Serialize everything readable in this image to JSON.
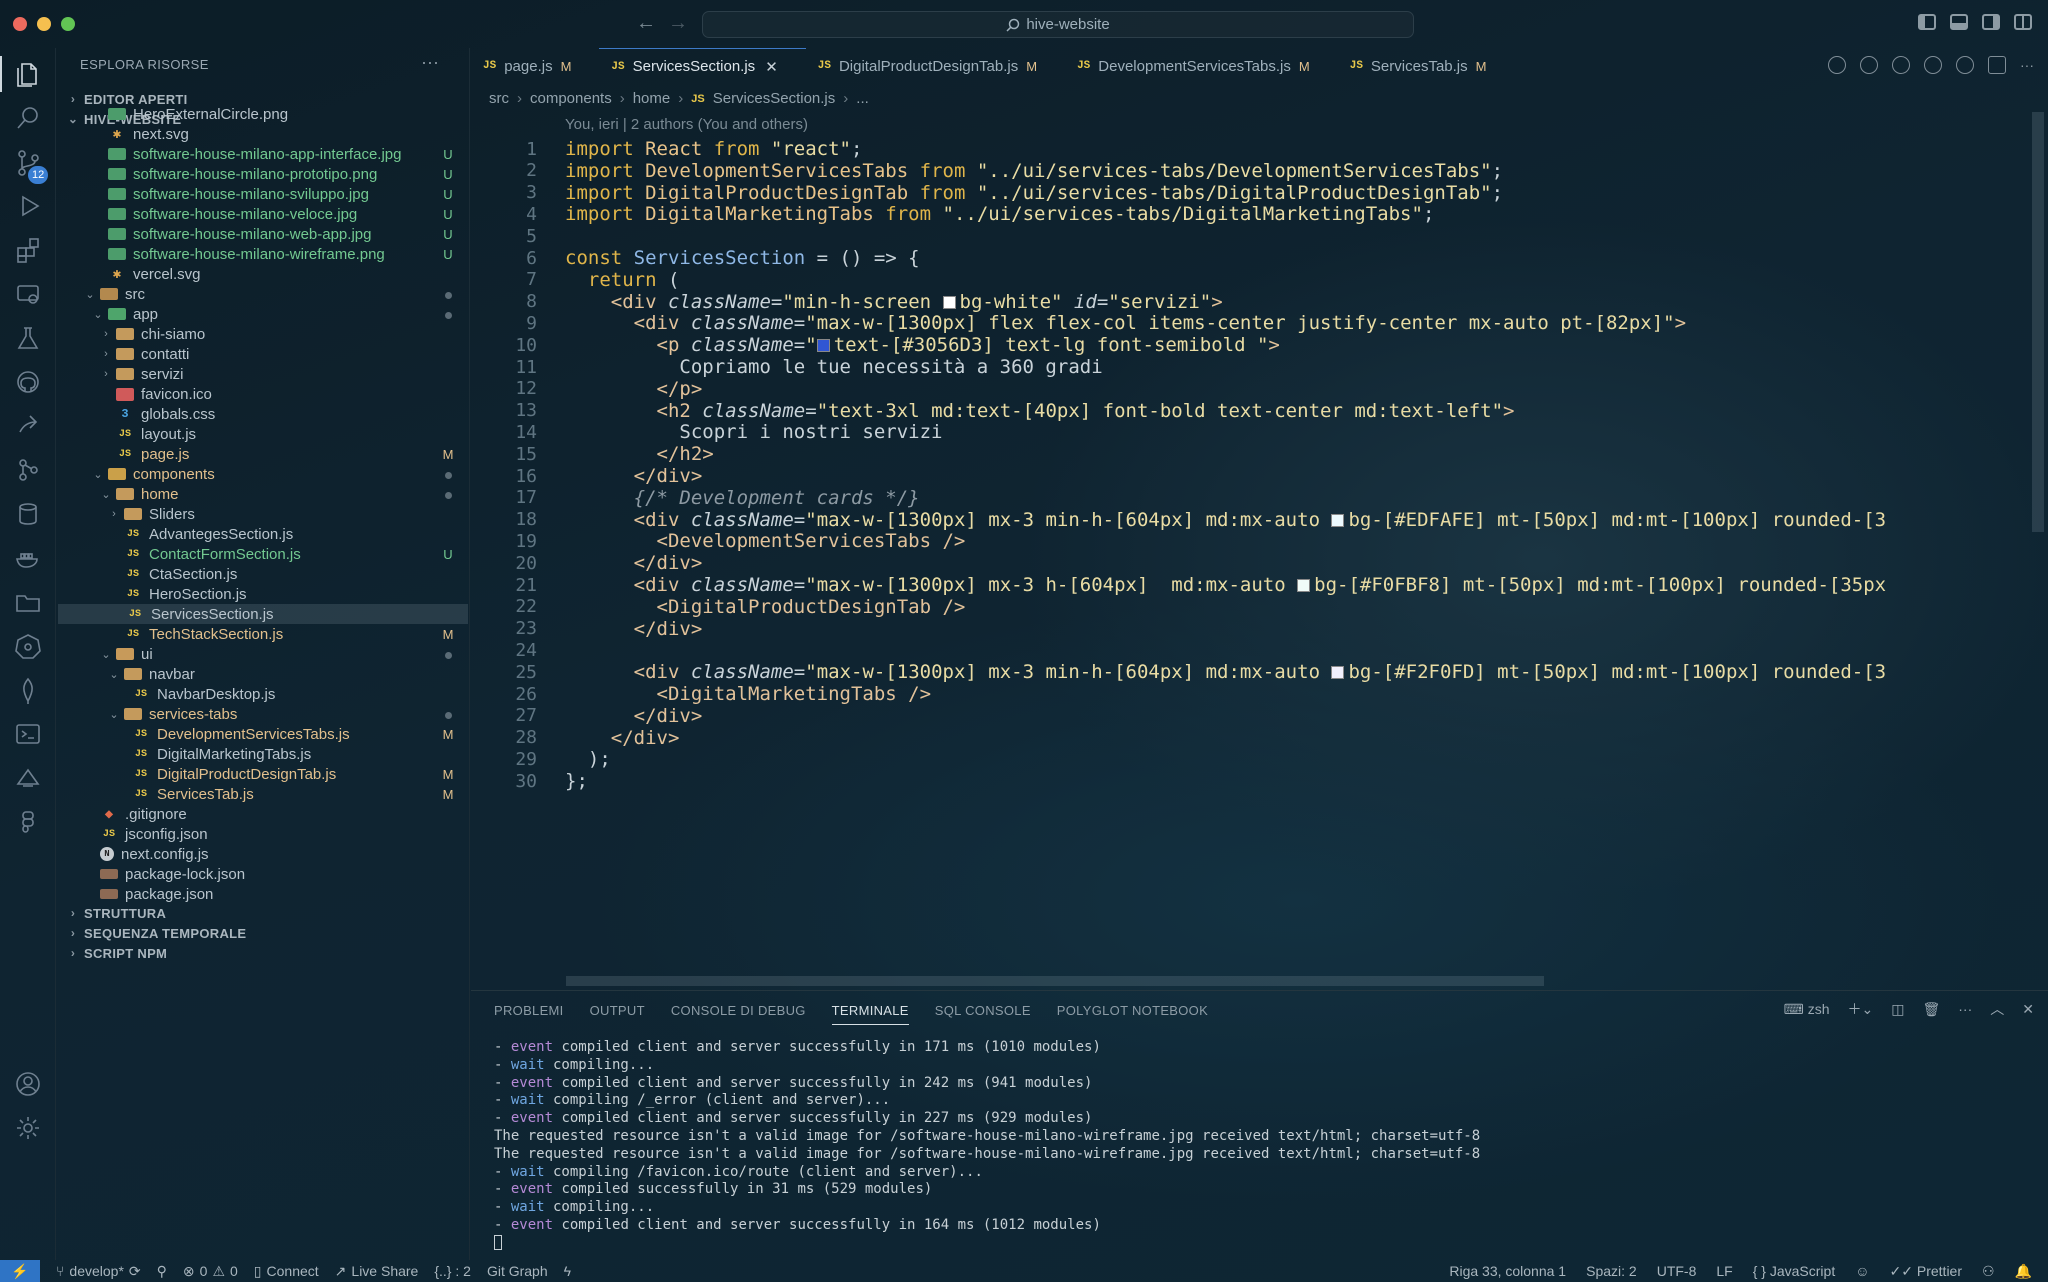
{
  "window": {
    "search": "hive-website"
  },
  "sidebar": {
    "title": "ESPLORA RISORSE",
    "sections": {
      "open_editors": "EDITOR APERTI",
      "project": "HIVE-WEBSITE",
      "outline": "STRUTTURA",
      "timeline": "SEQUENZA TEMPORALE",
      "npm": "SCRIPT NPM"
    },
    "source_control_badge": "12",
    "tree": [
      {
        "name": "HeroExternalCircle.png",
        "icon": "img",
        "indent": 1,
        "status": "",
        "color": "plain"
      },
      {
        "name": "next.svg",
        "icon": "svg",
        "indent": 1,
        "status": "",
        "color": "plain"
      },
      {
        "name": "software-house-milano-app-interface.jpg",
        "icon": "img",
        "indent": 1,
        "status": "U",
        "color": "green"
      },
      {
        "name": "software-house-milano-prototipo.png",
        "icon": "img",
        "indent": 1,
        "status": "U",
        "color": "green"
      },
      {
        "name": "software-house-milano-sviluppo.jpg",
        "icon": "img",
        "indent": 1,
        "status": "U",
        "color": "green"
      },
      {
        "name": "software-house-milano-veloce.jpg",
        "icon": "img",
        "indent": 1,
        "status": "U",
        "color": "green"
      },
      {
        "name": "software-house-milano-web-app.jpg",
        "icon": "img",
        "indent": 1,
        "status": "U",
        "color": "green"
      },
      {
        "name": "software-house-milano-wireframe.png",
        "icon": "img",
        "indent": 1,
        "status": "U",
        "color": "green"
      },
      {
        "name": "vercel.svg",
        "icon": "svg",
        "indent": 1,
        "status": "",
        "color": "plain"
      },
      {
        "name": "src",
        "icon": "folder-src",
        "indent": 0,
        "twisty": "open",
        "status": "dot",
        "color": "plain"
      },
      {
        "name": "app",
        "icon": "folder-app",
        "indent": 1,
        "twisty": "open",
        "status": "dot",
        "color": "plain"
      },
      {
        "name": "chi-siamo",
        "icon": "folder",
        "indent": 2,
        "twisty": "closed",
        "status": "",
        "color": "plain"
      },
      {
        "name": "contatti",
        "icon": "folder",
        "indent": 2,
        "twisty": "closed",
        "status": "",
        "color": "plain"
      },
      {
        "name": "servizi",
        "icon": "folder",
        "indent": 2,
        "twisty": "closed",
        "status": "",
        "color": "plain"
      },
      {
        "name": "favicon.ico",
        "icon": "ico",
        "indent": 2,
        "status": "",
        "color": "plain"
      },
      {
        "name": "globals.css",
        "icon": "css",
        "indent": 2,
        "status": "",
        "color": "plain"
      },
      {
        "name": "layout.js",
        "icon": "js",
        "indent": 2,
        "status": "",
        "color": "plain"
      },
      {
        "name": "page.js",
        "icon": "js",
        "indent": 2,
        "status": "M",
        "color": "yellow"
      },
      {
        "name": "components",
        "icon": "folder-comp",
        "indent": 1,
        "twisty": "open",
        "status": "dot",
        "color": "yellow"
      },
      {
        "name": "home",
        "icon": "folder",
        "indent": 2,
        "twisty": "open",
        "status": "dot",
        "color": "yellow"
      },
      {
        "name": "Sliders",
        "icon": "folder",
        "indent": 3,
        "twisty": "closed",
        "status": "",
        "color": "plain"
      },
      {
        "name": "AdvantegesSection.js",
        "icon": "js",
        "indent": 3,
        "status": "",
        "color": "plain"
      },
      {
        "name": "ContactFormSection.js",
        "icon": "js",
        "indent": 3,
        "status": "U",
        "color": "green"
      },
      {
        "name": "CtaSection.js",
        "icon": "js",
        "indent": 3,
        "status": "",
        "color": "plain"
      },
      {
        "name": "HeroSection.js",
        "icon": "js",
        "indent": 3,
        "status": "",
        "color": "plain"
      },
      {
        "name": "ServicesSection.js",
        "icon": "js",
        "indent": 3,
        "status": "",
        "color": "plain",
        "selected": true
      },
      {
        "name": "TechStackSection.js",
        "icon": "js",
        "indent": 3,
        "status": "M",
        "color": "yellow"
      },
      {
        "name": "ui",
        "icon": "folder-ui",
        "indent": 2,
        "twisty": "open",
        "status": "dot",
        "color": "plain"
      },
      {
        "name": "navbar",
        "icon": "folder",
        "indent": 3,
        "twisty": "open",
        "status": "",
        "color": "plain"
      },
      {
        "name": "NavbarDesktop.js",
        "icon": "js",
        "indent": 4,
        "status": "",
        "color": "plain"
      },
      {
        "name": "services-tabs",
        "icon": "folder",
        "indent": 3,
        "twisty": "open",
        "status": "dot",
        "color": "yellow"
      },
      {
        "name": "DevelopmentServicesTabs.js",
        "icon": "js",
        "indent": 4,
        "status": "M",
        "color": "yellow"
      },
      {
        "name": "DigitalMarketingTabs.js",
        "icon": "js",
        "indent": 4,
        "status": "",
        "color": "plain"
      },
      {
        "name": "DigitalProductDesignTab.js",
        "icon": "js",
        "indent": 4,
        "status": "M",
        "color": "yellow"
      },
      {
        "name": "ServicesTab.js",
        "icon": "js",
        "indent": 4,
        "status": "M",
        "color": "yellow"
      },
      {
        "name": ".gitignore",
        "icon": "git",
        "indent": 0,
        "status": "",
        "color": "plain"
      },
      {
        "name": "jsconfig.json",
        "icon": "js",
        "indent": 0,
        "status": "",
        "color": "plain"
      },
      {
        "name": "next.config.js",
        "icon": "next",
        "indent": 0,
        "status": "",
        "color": "plain"
      },
      {
        "name": "package-lock.json",
        "icon": "pkg",
        "indent": 0,
        "status": "",
        "color": "plain"
      },
      {
        "name": "package.json",
        "icon": "pkg",
        "indent": 0,
        "status": "",
        "color": "plain"
      }
    ]
  },
  "editor": {
    "tabs": [
      {
        "label": "page.js",
        "mod": "M",
        "active": false
      },
      {
        "label": "ServicesSection.js",
        "mod": "",
        "active": true
      },
      {
        "label": "DigitalProductDesignTab.js",
        "mod": "M",
        "active": false
      },
      {
        "label": "DevelopmentServicesTabs.js",
        "mod": "M",
        "active": false
      },
      {
        "label": "ServicesTab.js",
        "mod": "M",
        "active": false
      }
    ],
    "breadcrumb": [
      "src",
      "components",
      "home",
      "ServicesSection.js",
      "..."
    ],
    "blame": "You, ieri | 2 authors (You and others)",
    "lines": [
      [
        [
          "kw",
          "import "
        ],
        [
          "cls",
          "React"
        ],
        [
          "kw",
          " from "
        ],
        [
          "str",
          "\"react\""
        ],
        [
          "op",
          ";"
        ]
      ],
      [
        [
          "kw",
          "import "
        ],
        [
          "cls",
          "DevelopmentServicesTabs"
        ],
        [
          "kw",
          " from "
        ],
        [
          "str",
          "\"../ui/services-tabs/DevelopmentServicesTabs\""
        ],
        [
          "op",
          ";"
        ]
      ],
      [
        [
          "kw",
          "import "
        ],
        [
          "cls",
          "DigitalProductDesignTab"
        ],
        [
          "kw",
          " from "
        ],
        [
          "str",
          "\"../ui/services-tabs/DigitalProductDesignTab\""
        ],
        [
          "op",
          ";"
        ]
      ],
      [
        [
          "kw",
          "import "
        ],
        [
          "cls",
          "DigitalMarketingTabs"
        ],
        [
          "kw",
          " from "
        ],
        [
          "str",
          "\"../ui/services-tabs/DigitalMarketingTabs\""
        ],
        [
          "op",
          ";"
        ]
      ],
      [],
      [
        [
          "kw",
          "const "
        ],
        [
          "fn",
          "ServicesSection"
        ],
        [
          "op",
          " = () => {"
        ]
      ],
      [
        [
          "op",
          "  "
        ],
        [
          "kw",
          "return"
        ],
        [
          "op",
          " ("
        ]
      ],
      [
        [
          "op",
          "    "
        ],
        [
          "tag",
          "<div "
        ],
        [
          "attr",
          "className"
        ],
        [
          "op",
          "="
        ],
        [
          "str",
          "\"min-h-screen "
        ],
        [
          "sw",
          "#ffffff"
        ],
        [
          "str",
          "bg-white\" "
        ],
        [
          "attr",
          "id"
        ],
        [
          "op",
          "="
        ],
        [
          "str",
          "\"servizi\""
        ],
        [
          "tag",
          ">"
        ]
      ],
      [
        [
          "op",
          "      "
        ],
        [
          "tag",
          "<div "
        ],
        [
          "attr",
          "className"
        ],
        [
          "op",
          "="
        ],
        [
          "str",
          "\"max-w-[1300px] flex flex-col items-center justify-center mx-auto pt-[82px]\""
        ],
        [
          "tag",
          ">"
        ]
      ],
      [
        [
          "op",
          "        "
        ],
        [
          "tag",
          "<p "
        ],
        [
          "attr",
          "className"
        ],
        [
          "op",
          "="
        ],
        [
          "str",
          "\""
        ],
        [
          "sw",
          "#3056D3"
        ],
        [
          "str",
          "text-[#3056D3] text-lg font-semibold \""
        ],
        [
          "tag",
          ">"
        ]
      ],
      [
        [
          "txt",
          "          Copriamo le tue necessità a 360 gradi"
        ]
      ],
      [
        [
          "op",
          "        "
        ],
        [
          "tag",
          "</p>"
        ]
      ],
      [
        [
          "op",
          "        "
        ],
        [
          "tag",
          "<h2 "
        ],
        [
          "attr",
          "className"
        ],
        [
          "op",
          "="
        ],
        [
          "str",
          "\"text-3xl md:text-[40px] font-bold text-center md:text-left\""
        ],
        [
          "tag",
          ">"
        ]
      ],
      [
        [
          "txt",
          "          Scopri i nostri servizi"
        ]
      ],
      [
        [
          "op",
          "        "
        ],
        [
          "tag",
          "</h2>"
        ]
      ],
      [
        [
          "op",
          "      "
        ],
        [
          "tag",
          "</div>"
        ]
      ],
      [
        [
          "op",
          "      "
        ],
        [
          "cm",
          "{/* Development cards */}"
        ]
      ],
      [
        [
          "op",
          "      "
        ],
        [
          "tag",
          "<div "
        ],
        [
          "attr",
          "className"
        ],
        [
          "op",
          "="
        ],
        [
          "str",
          "\"max-w-[1300px] mx-3 min-h-[604px] md:mx-auto "
        ],
        [
          "sw",
          "#EDFAFE"
        ],
        [
          "str",
          "bg-[#EDFAFE] mt-[50px] md:mt-[100px] rounded-[3"
        ]
      ],
      [
        [
          "op",
          "        "
        ],
        [
          "tag",
          "<DevelopmentServicesTabs />"
        ]
      ],
      [
        [
          "op",
          "      "
        ],
        [
          "tag",
          "</div>"
        ]
      ],
      [
        [
          "op",
          "      "
        ],
        [
          "tag",
          "<div "
        ],
        [
          "attr",
          "className"
        ],
        [
          "op",
          "="
        ],
        [
          "str",
          "\"max-w-[1300px] mx-3 h-[604px]  md:mx-auto "
        ],
        [
          "sw",
          "#F0FBF8"
        ],
        [
          "str",
          "bg-[#F0FBF8] mt-[50px] md:mt-[100px] rounded-[35px"
        ]
      ],
      [
        [
          "op",
          "        "
        ],
        [
          "tag",
          "<DigitalProductDesignTab />"
        ]
      ],
      [
        [
          "op",
          "      "
        ],
        [
          "tag",
          "</div>"
        ]
      ],
      [],
      [
        [
          "op",
          "      "
        ],
        [
          "tag",
          "<div "
        ],
        [
          "attr",
          "className"
        ],
        [
          "op",
          "="
        ],
        [
          "str",
          "\"max-w-[1300px] mx-3 min-h-[604px] md:mx-auto "
        ],
        [
          "sw",
          "#F2F0FD"
        ],
        [
          "str",
          "bg-[#F2F0FD] mt-[50px] md:mt-[100px] rounded-[3"
        ]
      ],
      [
        [
          "op",
          "        "
        ],
        [
          "tag",
          "<DigitalMarketingTabs />"
        ]
      ],
      [
        [
          "op",
          "      "
        ],
        [
          "tag",
          "</div>"
        ]
      ],
      [
        [
          "op",
          "    "
        ],
        [
          "tag",
          "</div>"
        ]
      ],
      [
        [
          "op",
          "  );"
        ]
      ],
      [
        [
          "op",
          "};"
        ]
      ]
    ]
  },
  "panel": {
    "tabs": [
      "PROBLEMI",
      "OUTPUT",
      "CONSOLE DI DEBUG",
      "TERMINALE",
      "SQL CONSOLE",
      "POLYGLOT NOTEBOOK"
    ],
    "active_tab": "TERMINALE",
    "shell": "zsh",
    "terminal": [
      [
        "- ",
        "event",
        " compiled client and server successfully in 171 ms (1010 modules)"
      ],
      [
        "- ",
        "wait",
        " compiling..."
      ],
      [
        "- ",
        "event",
        " compiled client and server successfully in 242 ms (941 modules)"
      ],
      [
        "- ",
        "wait",
        " compiling /_error (client and server)..."
      ],
      [
        "- ",
        "event",
        " compiled client and server successfully in 227 ms (929 modules)"
      ],
      [
        "",
        "",
        "The requested resource isn't a valid image for /software-house-milano-wireframe.jpg received text/html; charset=utf-8"
      ],
      [
        "",
        "",
        "The requested resource isn't a valid image for /software-house-milano-wireframe.jpg received text/html; charset=utf-8"
      ],
      [
        "- ",
        "wait",
        " compiling /favicon.ico/route (client and server)..."
      ],
      [
        "- ",
        "event",
        " compiled successfully in 31 ms (529 modules)"
      ],
      [
        "- ",
        "wait",
        " compiling..."
      ],
      [
        "- ",
        "event",
        " compiled client and server successfully in 164 ms (1012 modules)"
      ]
    ]
  },
  "status": {
    "branch": "develop*",
    "errors": "0",
    "warnings": "0",
    "connect": "Connect",
    "live_share": "Live Share",
    "braces": "{..} : 2",
    "git_graph": "Git Graph",
    "position": "Riga 33, colonna 1",
    "spaces": "Spazi: 2",
    "encoding": "UTF-8",
    "eol": "LF",
    "language": "JavaScript",
    "prettier": "Prettier"
  }
}
